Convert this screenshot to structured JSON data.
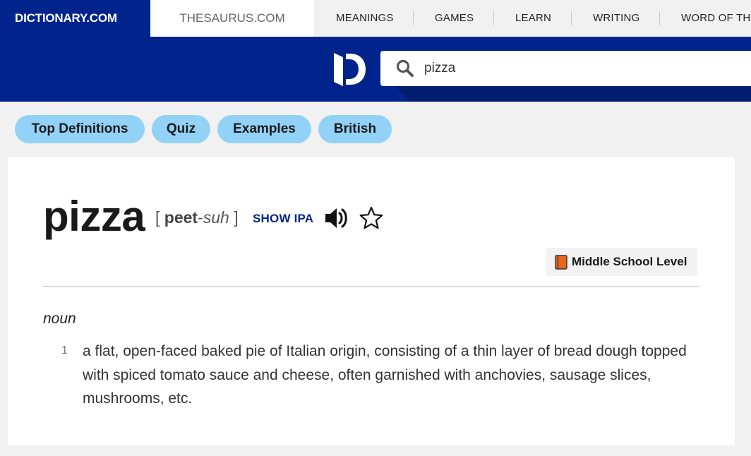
{
  "nav": {
    "dictionary_tab": "DICTIONARY.COM",
    "thesaurus_tab": "THESAURUS.COM",
    "links": [
      "MEANINGS",
      "GAMES",
      "LEARN",
      "WRITING",
      "WORD OF THE DAY"
    ]
  },
  "search": {
    "value": "pizza"
  },
  "section_pills": [
    "Top Definitions",
    "Quiz",
    "Examples",
    "British"
  ],
  "entry": {
    "headword": "pizza",
    "pron_open": "[",
    "pron_stressed": "peet",
    "pron_hyphen": "-",
    "pron_unstressed": "suh",
    "pron_close": "]",
    "show_ipa": "SHOW IPA",
    "level": "Middle School Level",
    "part_of_speech": "noun",
    "definitions": [
      {
        "number": "1",
        "text": "a flat, open-faced baked pie of Italian origin, consisting of a thin layer of bread dough topped with spiced tomato sauce and cheese, often garnished with anchovies, sausage slices, mushrooms, etc."
      }
    ]
  },
  "colors": {
    "brand_blue": "#00248b",
    "pill_blue": "#92d2f7",
    "level_book": "#e8661c"
  },
  "icons": [
    "dictionary-logo-icon",
    "search-icon",
    "speaker-icon",
    "star-icon",
    "book-icon"
  ]
}
